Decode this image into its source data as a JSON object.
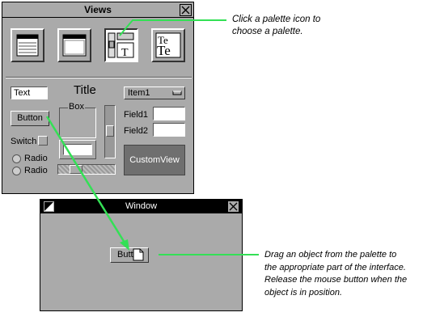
{
  "views_window": {
    "title": "Views",
    "top_palette_icons": [
      "cutoff-palette",
      "menu-palette",
      "text-palette",
      "fonts-palette"
    ],
    "text_field_value": "Text",
    "title_label": "Title",
    "pulldown_label": "Item1",
    "box_title": "Box",
    "button_label": "Button",
    "field1_label": "Field1",
    "field2_label": "Field2",
    "switch_label": "Switch",
    "radio1_label": "Radio",
    "radio2_label": "Radio",
    "customview_label": "CustomView"
  },
  "window": {
    "title": "Window",
    "dropped_button_label": "Button"
  },
  "callouts": {
    "palette": [
      "Click a palette icon to",
      "choose a palette."
    ],
    "drag": [
      "Drag an object from the palette to",
      "the appropriate part of the interface.",
      "Release the mouse button when the",
      "object is in position."
    ]
  },
  "colors": {
    "panel_gray": "#aaaaaa",
    "arrow_green": "#33e055",
    "customview_bg": "#6f6f6f"
  }
}
